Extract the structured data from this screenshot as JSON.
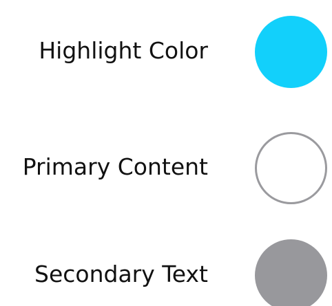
{
  "legend": {
    "items": [
      {
        "label": "Highlight Color",
        "color": "#12d0fb",
        "style": "filled"
      },
      {
        "label": "Primary Content",
        "color": "#ffffff",
        "border": "#9a9a9e",
        "style": "outlined"
      },
      {
        "label": "Secondary Text",
        "color": "#98989c",
        "style": "filled"
      }
    ]
  }
}
